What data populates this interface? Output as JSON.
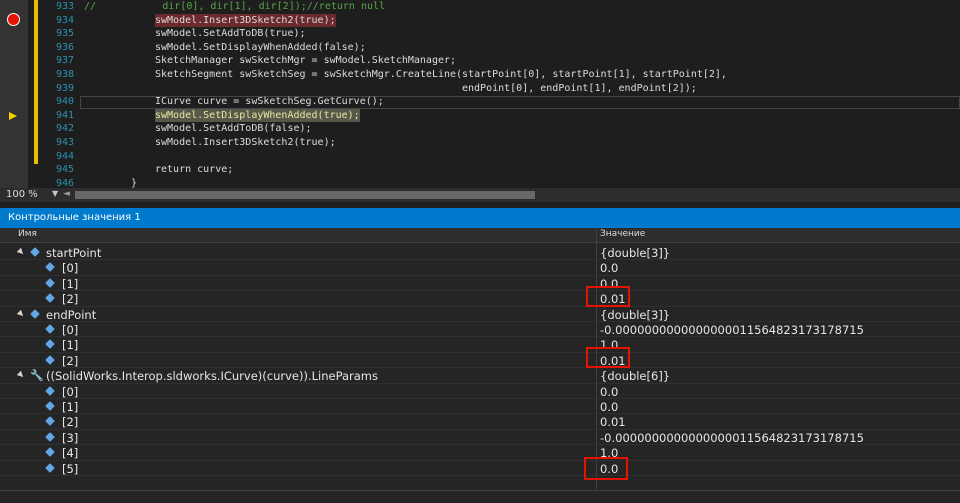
{
  "editor": {
    "line_numbers": [
      "933",
      "934",
      "935",
      "936",
      "937",
      "938",
      "939",
      "940",
      "941",
      "942",
      "943",
      "944",
      "945",
      "946"
    ],
    "lines": [
      {
        "text": "//           dir[0], dir[1], dir[2]);//return null"
      },
      {
        "text": "swModel.Insert3DSketch2(true);"
      },
      {
        "text": "swModel.SetAddToDB(true);"
      },
      {
        "text": "swModel.SetDisplayWhenAdded(false);"
      },
      {
        "text": "SketchManager swSketchMgr = swModel.SketchManager;"
      },
      {
        "text": "SketchSegment swSketchSeg = swSketchMgr.CreateLine(startPoint[0], startPoint[1], startPoint[2],"
      },
      {
        "text": "endPoint[0], endPoint[1], endPoint[2]);"
      },
      {
        "text": "ICurve curve = swSketchSeg.GetCurve();"
      },
      {
        "text": "swModel.SetDisplayWhenAdded(true);"
      },
      {
        "text": "swModel.SetAddToDB(false);"
      },
      {
        "text": "swModel.Insert3DSketch2(true);"
      },
      {
        "text": ""
      },
      {
        "text": "return curve;"
      },
      {
        "text": "}"
      }
    ],
    "zoom": "100 %"
  },
  "watch": {
    "title": "Контрольные значения 1",
    "col_name": "Имя",
    "col_value": "Значение",
    "rows": [
      {
        "name": "startPoint",
        "value": "{double[3]}"
      },
      {
        "name": "[0]",
        "value": "0.0"
      },
      {
        "name": "[1]",
        "value": "0.0"
      },
      {
        "name": "[2]",
        "value": "0.01"
      },
      {
        "name": "endPoint",
        "value": "{double[3]}"
      },
      {
        "name": "[0]",
        "value": "-0.0000000000000000011564823173178715"
      },
      {
        "name": "[1]",
        "value": "1.0"
      },
      {
        "name": "[2]",
        "value": "0.01"
      },
      {
        "name": "((SolidWorks.Interop.sldworks.ICurve)(curve)).LineParams",
        "value": "{double[6]}"
      },
      {
        "name": "[0]",
        "value": "0.0"
      },
      {
        "name": "[1]",
        "value": "0.0"
      },
      {
        "name": "[2]",
        "value": "0.01"
      },
      {
        "name": "[3]",
        "value": "-0.0000000000000000011564823173178715"
      },
      {
        "name": "[4]",
        "value": "1.0"
      },
      {
        "name": "[5]",
        "value": "0.0"
      }
    ]
  },
  "colors": {
    "accent": "#007acc",
    "breakpoint": "#e51400",
    "highlight_box": "#e51400"
  }
}
